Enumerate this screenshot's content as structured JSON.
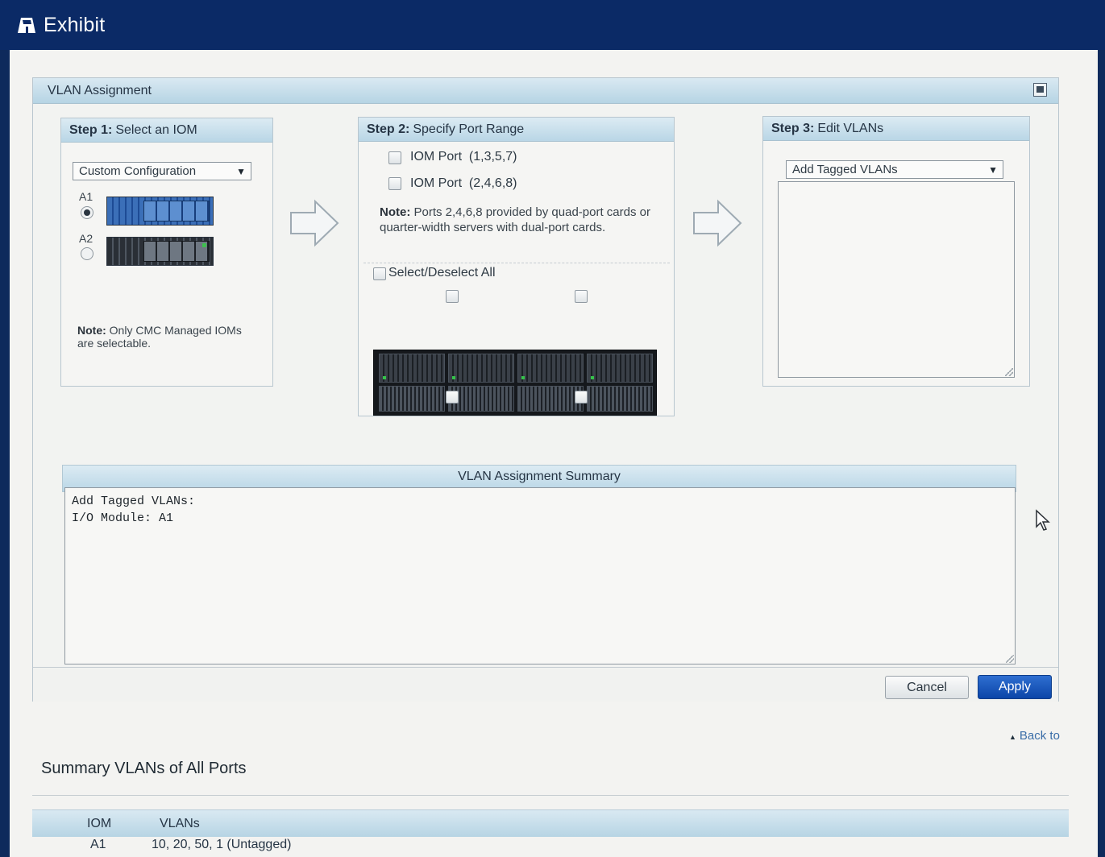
{
  "window": {
    "title": "Exhibit",
    "title_icon": "exhibit-icon"
  },
  "panel": {
    "title": "VLAN Assignment",
    "restore_icon": "restore-icon"
  },
  "step1": {
    "prefix": "Step 1:",
    "title": "Select an IOM",
    "dropdown_value": "Custom Configuration",
    "options": [
      {
        "label": "A1",
        "selected": true
      },
      {
        "label": "A2",
        "selected": false
      }
    ],
    "note_bold": "Note:",
    "note_text": "Only CMC Managed IOMs are selectable."
  },
  "step2": {
    "prefix": "Step 2:",
    "title": "Specify Port Range",
    "port_odd_label": "IOM Port  (1,3,5,7)",
    "port_even_label": "IOM Port  (2,4,6,8)",
    "note_bold": "Note:",
    "note_text": "Ports 2,4,6,8 provided by quad-port cards or quarter-width servers with dual-port cards.",
    "select_all_label": "Select/Deselect All"
  },
  "step3": {
    "prefix": "Step 3:",
    "title": "Edit VLANs",
    "dropdown_value": "Add Tagged VLANs"
  },
  "summary": {
    "title": "VLAN Assignment Summary",
    "text": "Add Tagged VLANs:\nI/O Module: A1"
  },
  "buttons": {
    "cancel": "Cancel",
    "apply": "Apply"
  },
  "back_link": "Back to",
  "vlans_table": {
    "title": "Summary VLANs of All Ports",
    "columns": [
      "IOM",
      "VLANs"
    ],
    "rows": [
      [
        "A1",
        "10, 20, 50, 1 (Untagged)"
      ]
    ]
  },
  "colors": {
    "titlebar": "#0b2a66",
    "apply_button": "#1a56b8",
    "header_gradient": "#c6dfec",
    "link": "#3b6ea8"
  }
}
